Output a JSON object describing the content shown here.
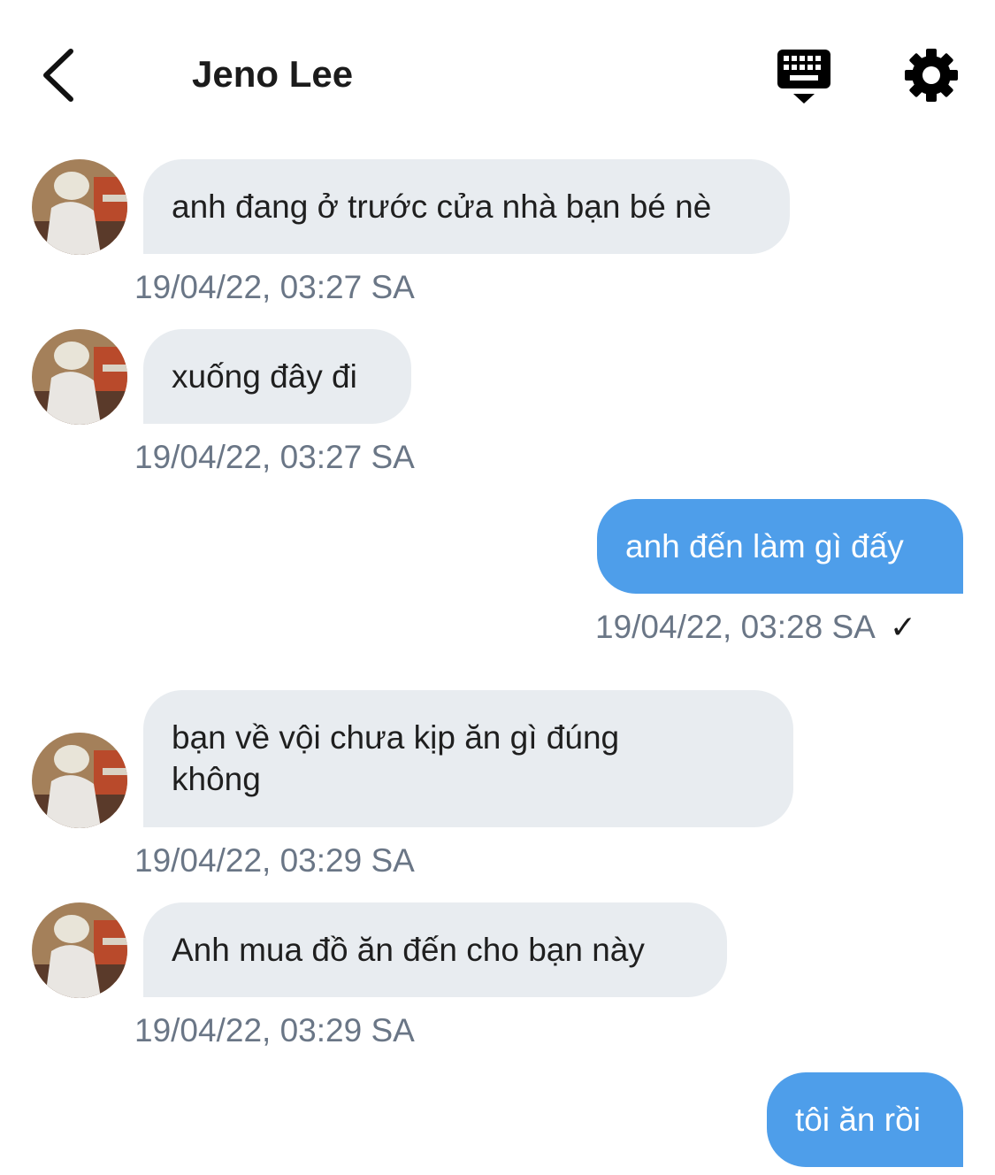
{
  "header": {
    "back_icon": "chevron-left-icon",
    "title": "Jeno Lee",
    "keyboard_icon": "keyboard-icon",
    "settings_icon": "gear-icon"
  },
  "colors": {
    "incoming_bubble": "#e8ecf0",
    "outgoing_bubble": "#4e9eea",
    "timestamp": "#6a7686"
  },
  "messages": [
    {
      "direction": "incoming",
      "text": "anh đang ở trước cửa nhà bạn bé nè",
      "time": "19/04/22, 03:27 SA"
    },
    {
      "direction": "incoming",
      "text": "xuống đây đi",
      "time": "19/04/22, 03:27 SA"
    },
    {
      "direction": "outgoing",
      "text": "anh đến làm gì đấy",
      "time": "19/04/22, 03:28 SA",
      "status": "✓"
    },
    {
      "direction": "incoming",
      "text": "bạn về vội chưa kịp ăn gì đúng không",
      "time": "19/04/22, 03:29 SA"
    },
    {
      "direction": "incoming",
      "text": "Anh mua đồ ăn đến cho bạn này",
      "time": "19/04/22, 03:29 SA"
    },
    {
      "direction": "outgoing",
      "text": "tôi ăn rồi"
    }
  ]
}
